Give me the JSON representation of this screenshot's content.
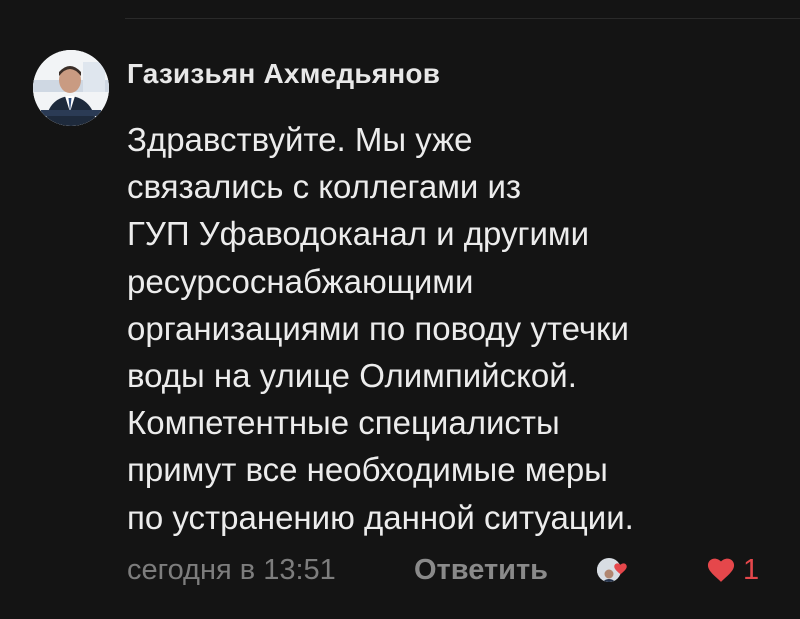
{
  "comment": {
    "author": "Газизьян Ахмедьянов",
    "avatar_icon": "user-avatar-photo",
    "text_lines": [
      "Здравствуйте. Мы уже",
      "связались с коллегами из",
      "ГУП Уфаводоканал и другими",
      "ресурсоснабжающими",
      "организациями по поводу утечки",
      "воды на улице Олимпийской.",
      "Компетентные специалисты",
      "примут все необходимые меры",
      "по устранению данной ситуации."
    ],
    "timestamp": "сегодня в 13:51",
    "reply_label": "Ответить",
    "liked_by_icon": "liker-avatar-with-heart",
    "likes": {
      "icon": "heart-icon",
      "count": "1"
    }
  },
  "colors": {
    "background": "#141414",
    "text": "#ececec",
    "muted": "#7d7d7d",
    "like": "#e5474b"
  }
}
